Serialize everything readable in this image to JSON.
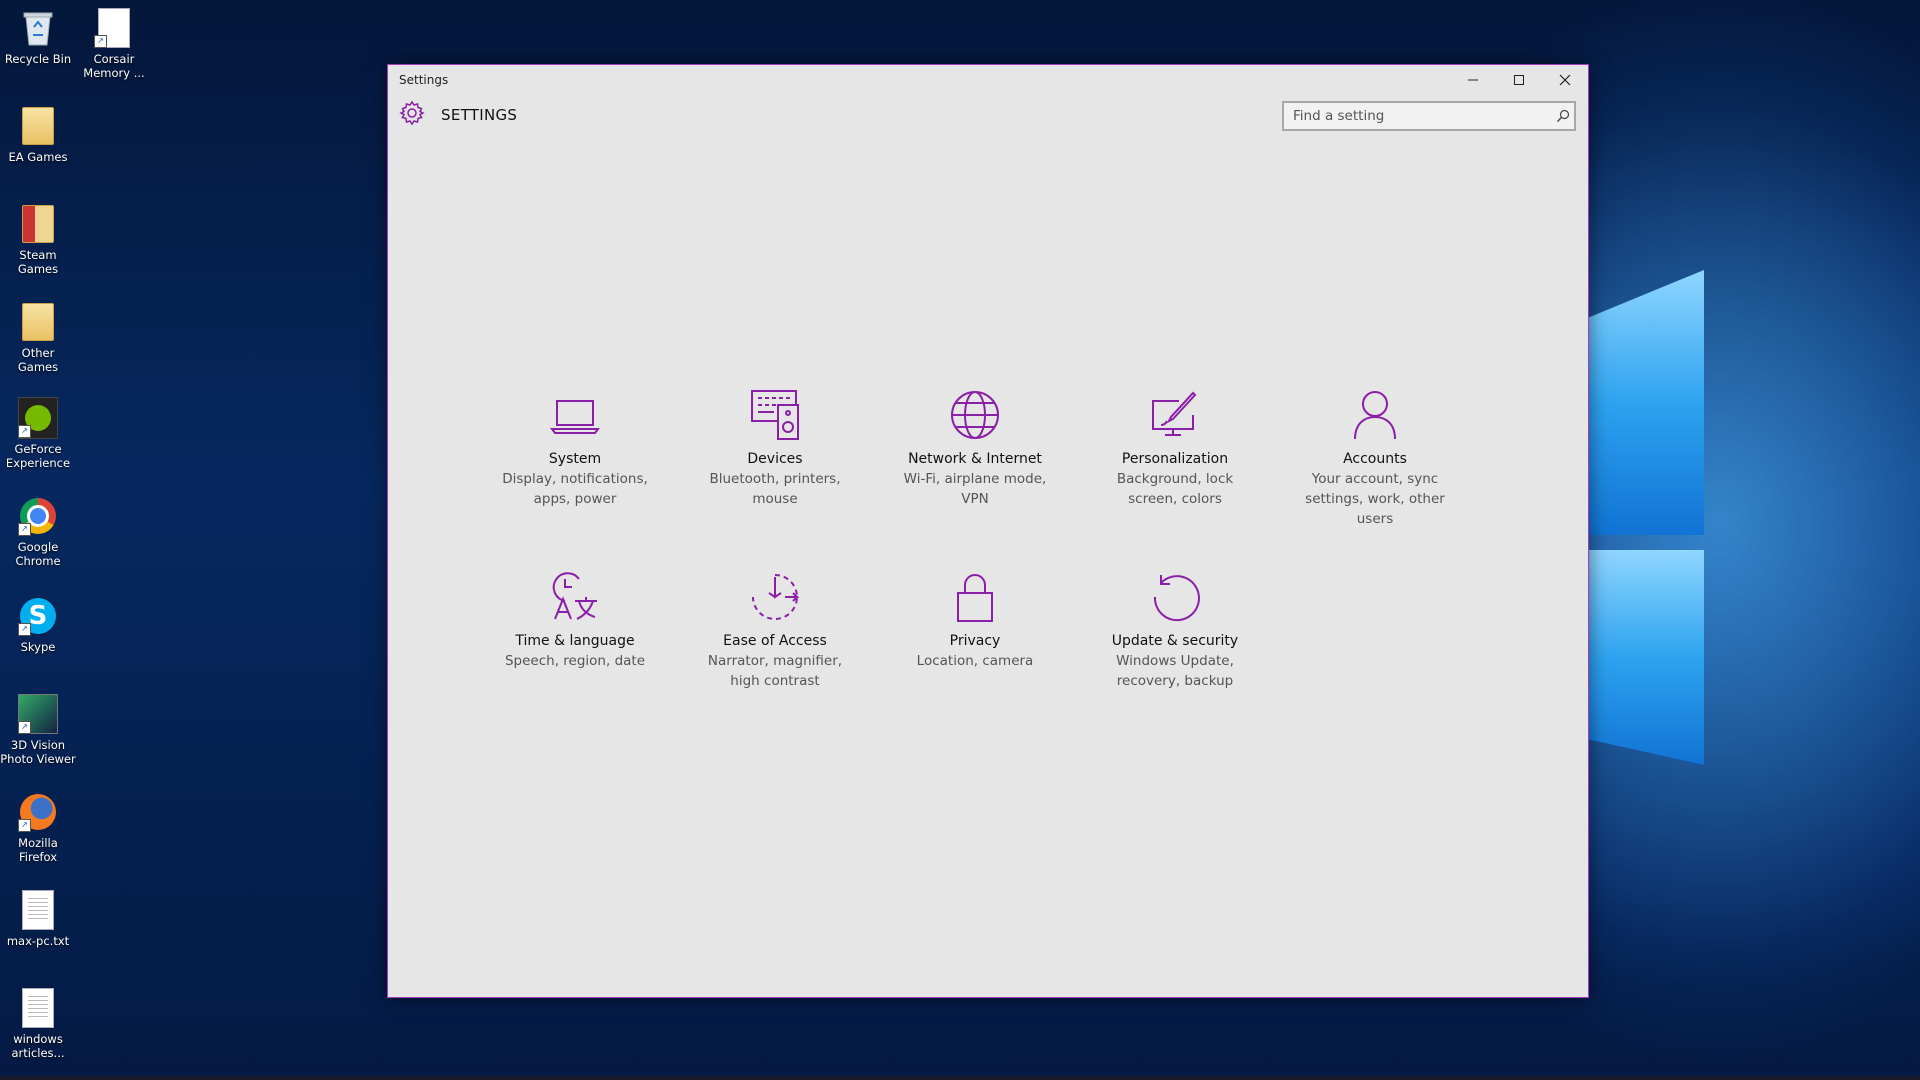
{
  "desktop": {
    "icons": [
      {
        "label": "Recycle Bin",
        "icon": "recycle-bin-icon"
      },
      {
        "label": "Corsair Memory ...",
        "icon": "document-icon"
      },
      {
        "label": "EA Games",
        "icon": "folder-icon"
      },
      {
        "label": "Steam Games",
        "icon": "folder-icon"
      },
      {
        "label": "Other Games",
        "icon": "folder-icon"
      },
      {
        "label": "GeForce Experience",
        "icon": "geforce-icon"
      },
      {
        "label": "Google Chrome",
        "icon": "chrome-icon"
      },
      {
        "label": "Skype",
        "icon": "skype-icon"
      },
      {
        "label": "3D Vision Photo Viewer",
        "icon": "3d-vision-icon"
      },
      {
        "label": "Mozilla Firefox",
        "icon": "firefox-icon"
      },
      {
        "label": "max-pc.txt",
        "icon": "text-file-icon"
      },
      {
        "label": "windows articles...",
        "icon": "text-file-icon"
      }
    ]
  },
  "window": {
    "title": "Settings",
    "accent_color": "#8a1fa8",
    "header": {
      "title": "SETTINGS"
    },
    "search": {
      "placeholder": "Find a setting"
    },
    "tiles": [
      {
        "title": "System",
        "desc": "Display, notifications, apps, power",
        "icon": "laptop-icon"
      },
      {
        "title": "Devices",
        "desc": "Bluetooth, printers, mouse",
        "icon": "devices-icon"
      },
      {
        "title": "Network & Internet",
        "desc": "Wi-Fi, airplane mode, VPN",
        "icon": "globe-icon"
      },
      {
        "title": "Personalization",
        "desc": "Background, lock screen, colors",
        "icon": "paintbrush-icon"
      },
      {
        "title": "Accounts",
        "desc": "Your account, sync settings, work, other users",
        "icon": "person-icon"
      },
      {
        "title": "Time & language",
        "desc": "Speech, region, date",
        "icon": "time-language-icon"
      },
      {
        "title": "Ease of Access",
        "desc": "Narrator, magnifier, high contrast",
        "icon": "ease-of-access-icon"
      },
      {
        "title": "Privacy",
        "desc": "Location, camera",
        "icon": "lock-icon"
      },
      {
        "title": "Update & security",
        "desc": "Windows Update, recovery, backup",
        "icon": "refresh-icon"
      }
    ]
  }
}
